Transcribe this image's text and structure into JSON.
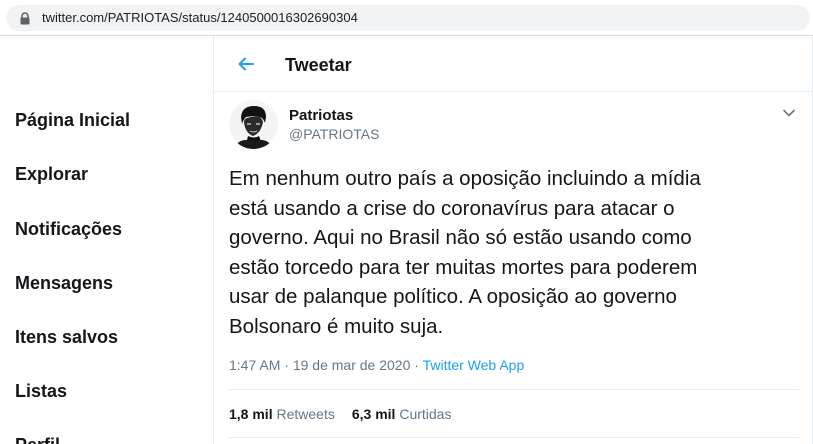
{
  "browser": {
    "url": "twitter.com/PATRIOTAS/status/1240500016302690304"
  },
  "sidebar": {
    "items": [
      {
        "label": "Página Inicial"
      },
      {
        "label": "Explorar"
      },
      {
        "label": "Notificações"
      },
      {
        "label": "Mensagens"
      },
      {
        "label": "Itens salvos"
      },
      {
        "label": "Listas"
      },
      {
        "label": "Perfil"
      }
    ]
  },
  "header": {
    "title": "Tweetar"
  },
  "tweet": {
    "author_name": "Patriotas",
    "author_handle": "@PATRIOTAS",
    "text_lines": [
      "Em nenhum outro país a oposição incluindo a mídia",
      "está usando a crise do coronavírus para atacar o",
      "governo. Aqui no Brasil não só estão usando como",
      "estão torcedo para ter muitas mortes para poderem",
      "usar de palanque político. A oposição ao governo",
      "Bolsonaro é muito suja."
    ],
    "time": "1:47 AM",
    "separator": "·",
    "date": "19 de mar de 2020",
    "app": "Twitter Web App",
    "retweets_count": "1,8 mil",
    "retweets_label": "Retweets",
    "likes_count": "6,3 mil",
    "likes_label": "Curtidas"
  },
  "colors": {
    "accent": "#1da1f2",
    "secondary_text": "#657786",
    "primary_text": "#14171a",
    "divider": "#e6ecf0"
  },
  "icons": {
    "lock": "lock-icon",
    "back": "arrow-left-icon",
    "caret": "chevron-down-icon"
  }
}
